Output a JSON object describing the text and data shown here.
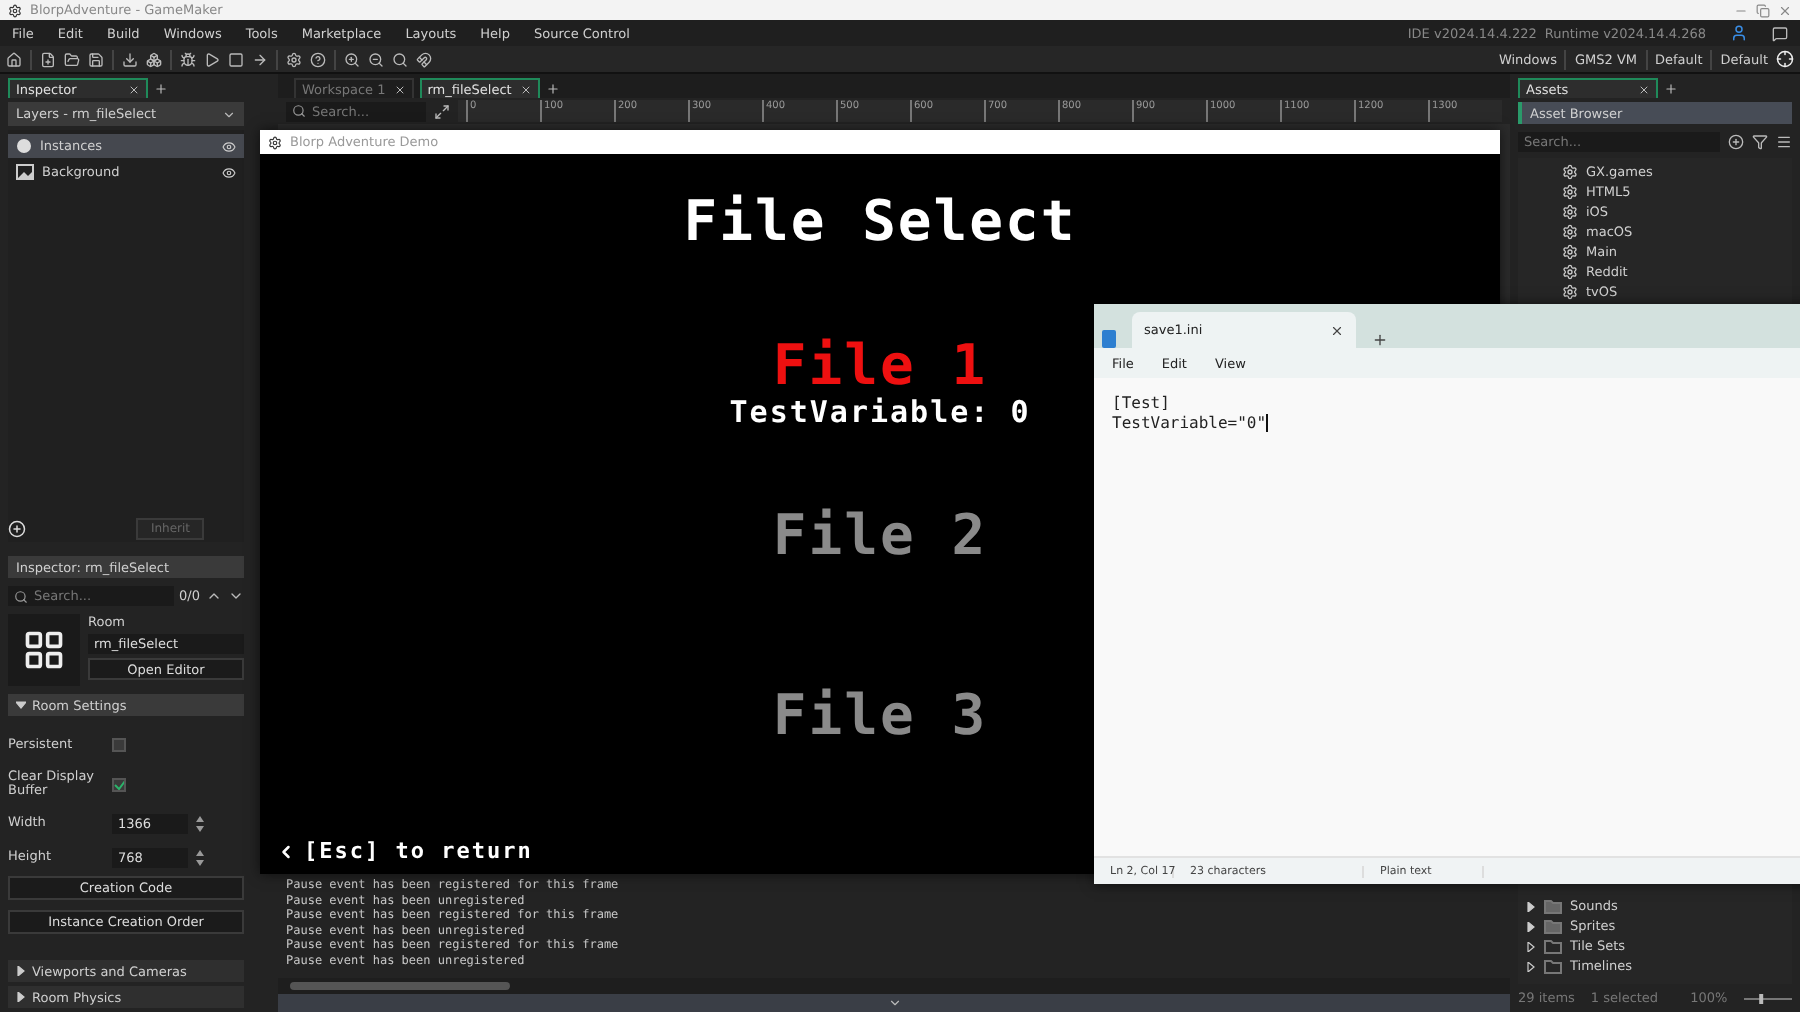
{
  "window": {
    "title": "BlorpAdventure - GameMaker"
  },
  "menu": [
    "File",
    "Edit",
    "Build",
    "Windows",
    "Tools",
    "Marketplace",
    "Layouts",
    "Help",
    "Source Control"
  ],
  "version": {
    "ide": "IDE v2024.14.4.222",
    "runtime": "Runtime v2024.14.4.268"
  },
  "target_bar": [
    "Windows",
    "GMS2 VM",
    "Default",
    "Default"
  ],
  "left_dock": {
    "tabs": [
      {
        "label": "Inspector",
        "selected": true
      }
    ],
    "layers_dropdown": "Layers - rm_fileSelect",
    "layers": [
      {
        "name": "Instances",
        "kind": "instances",
        "selected": true
      },
      {
        "name": "Background",
        "kind": "background",
        "selected": false
      }
    ],
    "inherit_button": "Inherit",
    "inspector": {
      "title": "Inspector: rm_fileSelect",
      "search_placeholder": "Search...",
      "match_count": "0/0",
      "asset_type": "Room",
      "asset_name": "rm_fileSelect",
      "open_button": "Open Editor",
      "section": {
        "title": "Room Settings",
        "expanded": true
      },
      "fields": [
        {
          "kind": "checkbox",
          "label": "Persistent",
          "checked": false
        },
        {
          "kind": "checkbox",
          "label": "Clear Display Buffer",
          "checked": true
        },
        {
          "kind": "number",
          "label": "Width",
          "value": "1366"
        },
        {
          "kind": "number",
          "label": "Height",
          "value": "768"
        }
      ],
      "buttons": [
        "Creation Code",
        "Instance Creation Order"
      ],
      "collapsed_sections": [
        {
          "title": "Viewports and Cameras",
          "expanded": false
        },
        {
          "title": "Room Physics",
          "expanded": false
        }
      ]
    }
  },
  "center": {
    "tabs": [
      {
        "label": "Workspace 1",
        "selected": false
      },
      {
        "label": "rm_fileSelect",
        "selected": true
      }
    ],
    "search_placeholder": "Search...",
    "ruler": [
      "0",
      "100",
      "200",
      "300",
      "400",
      "500",
      "600",
      "700",
      "800",
      "900",
      "1000",
      "1100",
      "1200",
      "1300"
    ],
    "output": [
      "Pause event has been registered for this frame",
      "Pause event has been unregistered",
      "Pause event has been registered for this frame",
      "Pause event has been unregistered",
      "Pause event has been registered for this frame",
      "Pause event has been unregistered"
    ]
  },
  "right_dock": {
    "tabs": [
      {
        "label": "Assets",
        "selected": true
      }
    ],
    "header": "Asset Browser",
    "search_placeholder": "Search...",
    "configs": [
      "GX.games",
      "HTML5",
      "iOS",
      "macOS",
      "Main",
      "Reddit",
      "tvOS"
    ],
    "folders": [
      {
        "name": "Sounds",
        "filled": true
      },
      {
        "name": "Sprites",
        "filled": true
      },
      {
        "name": "Tile Sets",
        "filled": false
      },
      {
        "name": "Timelines",
        "filled": false
      }
    ],
    "footer": {
      "count": "29 items",
      "selected": "1 selected",
      "zoom": "100%",
      "level": 0.2
    }
  },
  "game_window": {
    "title": "Blorp Adventure Demo",
    "heading": "File Select",
    "files": [
      {
        "label": "File 1",
        "selected": true,
        "detail": "TestVariable: 0"
      },
      {
        "label": "File 2",
        "selected": false
      },
      {
        "label": "File 3",
        "selected": false
      }
    ],
    "back_hint": "[Esc] to return"
  },
  "notepad": {
    "tab": "save1.ini",
    "menu": [
      "File",
      "Edit",
      "View"
    ],
    "lines": [
      "[Test]",
      "TestVariable=\"0\""
    ],
    "status": [
      "Ln 2, Col 17",
      "23 characters",
      "Plain text"
    ]
  }
}
